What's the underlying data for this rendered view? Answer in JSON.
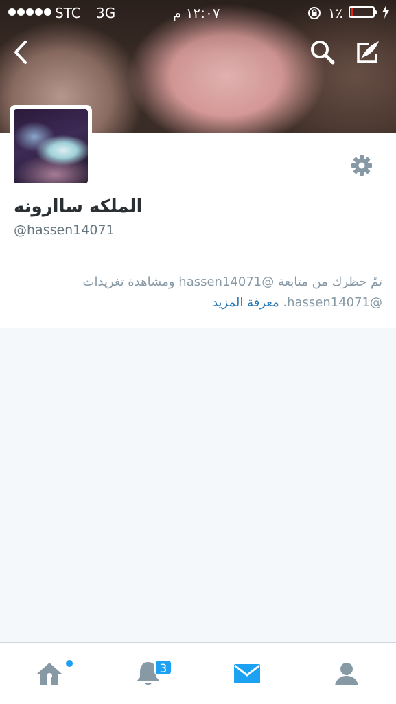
{
  "status_bar": {
    "carrier": "STC",
    "network": "3G",
    "time": "١٢:٠٧ م",
    "battery_percent": "١٪",
    "battery_level": 0.08
  },
  "profile": {
    "display_name": "الملكه ساارونه",
    "screen_name": "@hassen14071",
    "blocked_line1": "تمّ حظرك من متابعة @hassen14071 ومشاهدة تغريدات",
    "blocked_line2": "@hassen14071.",
    "learn_more": "معرفة المزيد"
  },
  "tab_bar": {
    "notifications_badge": "3"
  },
  "colors": {
    "accent": "#1da1f2",
    "icon_gray": "#8899a6",
    "link": "#2b7bb9"
  },
  "icons": {
    "back": "chevron-left-icon",
    "search": "magnifier-icon",
    "compose": "quill-icon",
    "settings": "gear-icon",
    "home": "home-icon",
    "notifications": "bell-icon",
    "messages": "envelope-icon",
    "me": "person-icon"
  }
}
